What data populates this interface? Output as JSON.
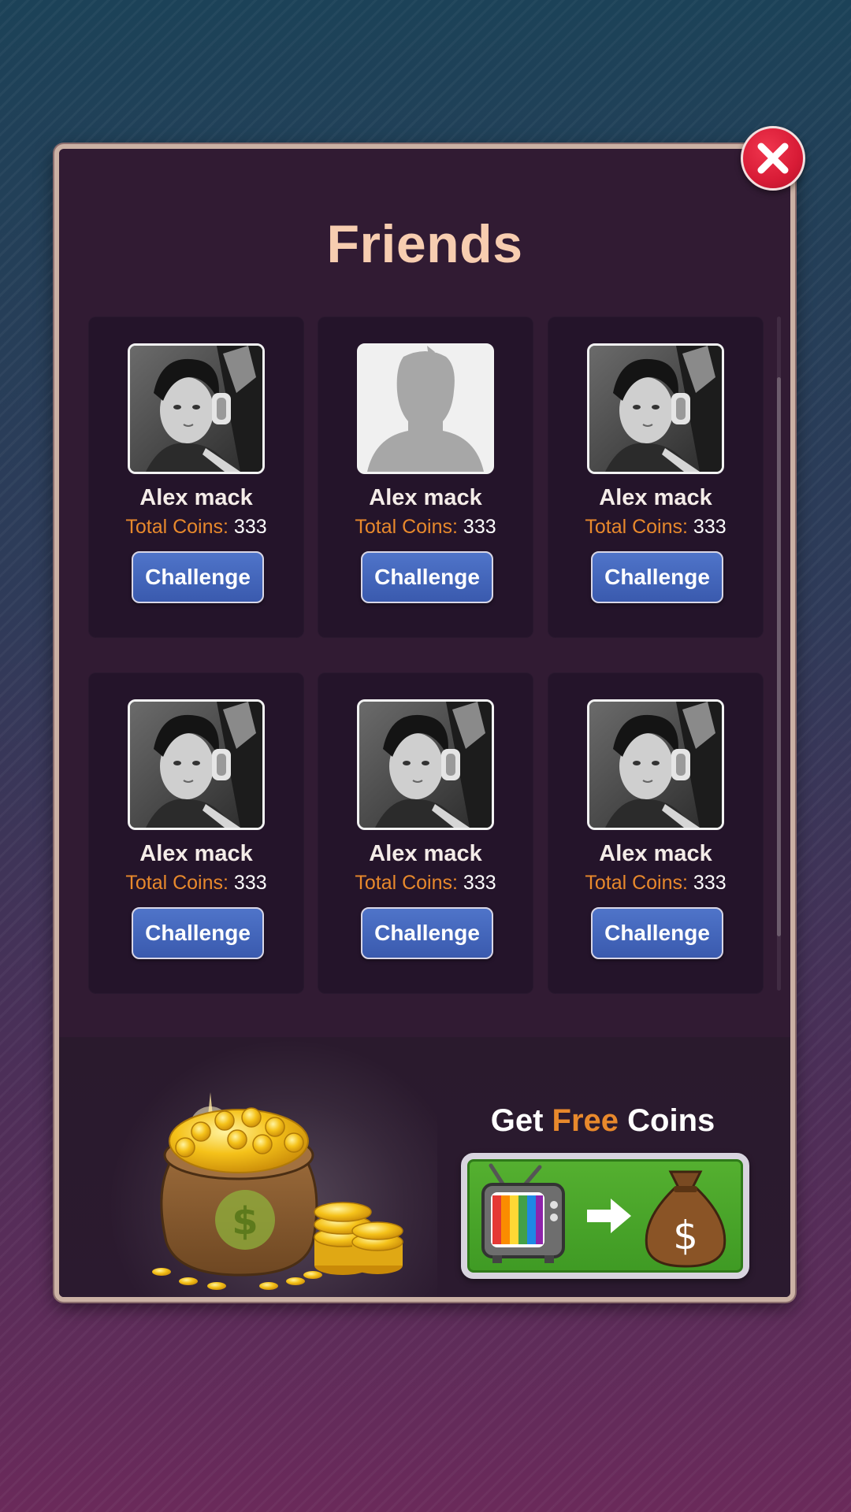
{
  "header": {
    "title": "Friends"
  },
  "friends": [
    {
      "name": "Alex mack",
      "coins_label": "Total Coins:",
      "coins": "333",
      "avatar": "photo",
      "button": "Challenge"
    },
    {
      "name": "Alex mack",
      "coins_label": "Total Coins:",
      "coins": "333",
      "avatar": "silhouette-placeholder",
      "button": "Challenge"
    },
    {
      "name": "Alex mack",
      "coins_label": "Total Coins:",
      "coins": "333",
      "avatar": "photo",
      "button": "Challenge"
    },
    {
      "name": "Alex mack",
      "coins_label": "Total Coins:",
      "coins": "333",
      "avatar": "photo",
      "button": "Challenge"
    },
    {
      "name": "Alex mack",
      "coins_label": "Total Coins:",
      "coins": "333",
      "avatar": "photo",
      "button": "Challenge"
    },
    {
      "name": "Alex mack",
      "coins_label": "Total Coins:",
      "coins": "333",
      "avatar": "photo",
      "button": "Challenge"
    }
  ],
  "footer": {
    "get": "Get",
    "free": "Free",
    "coins": "Coins"
  },
  "icons": {
    "close": "close-icon",
    "watch_ad": "tv-icon",
    "arrow": "arrow-right-icon",
    "reward": "money-bag-icon",
    "decoration": "coin-bag-icon"
  },
  "colors": {
    "accent": "#e8892c",
    "title": "#f7cdb0",
    "button": "#3a5aae",
    "close": "#d81b36",
    "ad_button": "#4aa52a"
  }
}
